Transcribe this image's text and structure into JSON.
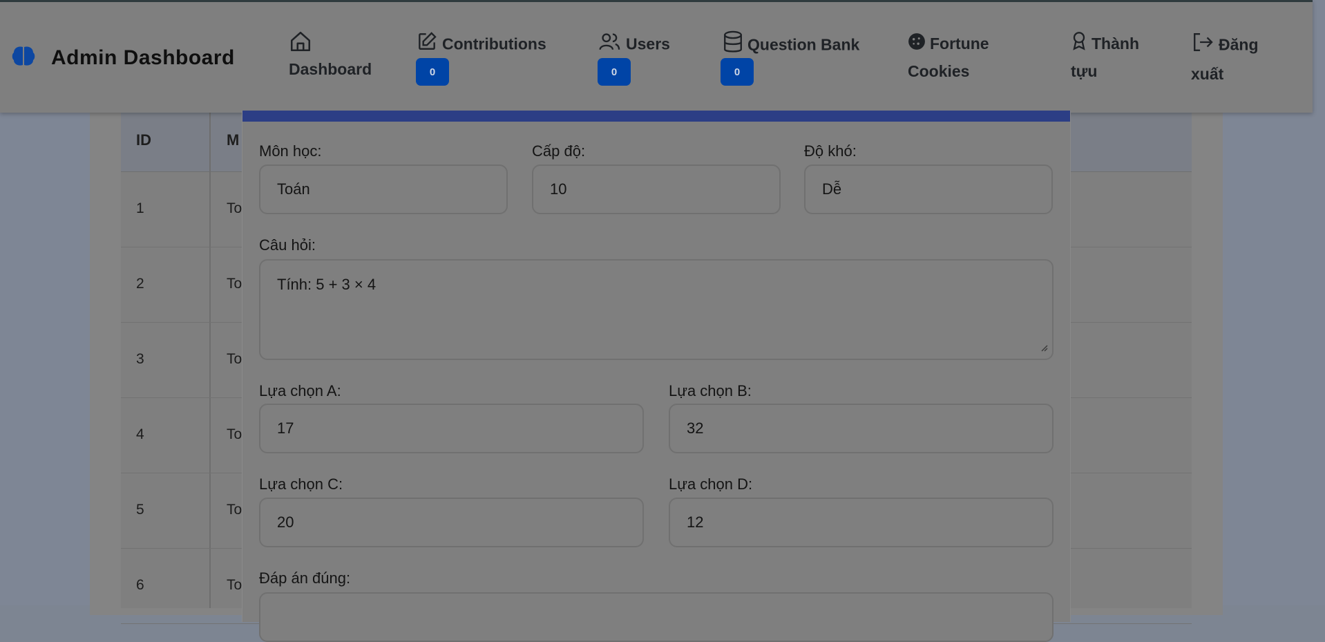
{
  "header": {
    "brand_title": "Admin Dashboard",
    "nav": [
      {
        "label": "Dashboard",
        "icon": "home-icon"
      },
      {
        "label": "Contributions",
        "icon": "edit-icon",
        "badge": "0"
      },
      {
        "label": "Users",
        "icon": "users-icon",
        "badge": "0"
      },
      {
        "label": "Question Bank",
        "icon": "database-icon",
        "badge": "0"
      },
      {
        "label_line1": "Fortune",
        "label_line2": "Cookies",
        "icon": "cookie-icon"
      },
      {
        "label_line1": "Thành",
        "label_line2": "tựu",
        "icon": "award-icon"
      },
      {
        "label_line1": "Đăng",
        "label_line2": "xuất",
        "icon": "logout-icon"
      }
    ]
  },
  "table": {
    "headers": [
      "ID",
      "M"
    ],
    "rows": [
      {
        "id": "1",
        "subject": "To"
      },
      {
        "id": "2",
        "subject": "To"
      },
      {
        "id": "3",
        "subject": "To"
      },
      {
        "id": "4",
        "subject": "To"
      },
      {
        "id": "5",
        "subject": "To"
      },
      {
        "id": "6",
        "subject": "To"
      }
    ]
  },
  "modal": {
    "subject_label": "Môn học:",
    "subject_value": "Toán",
    "level_label": "Cấp độ:",
    "level_value": "10",
    "difficulty_label": "Độ khó:",
    "difficulty_value": "Dễ",
    "question_label": "Câu hỏi:",
    "question_value": "Tính: 5 + 3 × 4",
    "option_a_label": "Lựa chọn A:",
    "option_a_value": "17",
    "option_b_label": "Lựa chọn B:",
    "option_b_value": "32",
    "option_c_label": "Lựa chọn C:",
    "option_c_value": "20",
    "option_d_label": "Lựa chọn D:",
    "option_d_value": "12",
    "answer_label": "Đáp án đúng:"
  },
  "colors": {
    "accent_bar": "#2c3e85",
    "badge_bg": "#0044a6",
    "brand_icon": "#0d47a1"
  }
}
